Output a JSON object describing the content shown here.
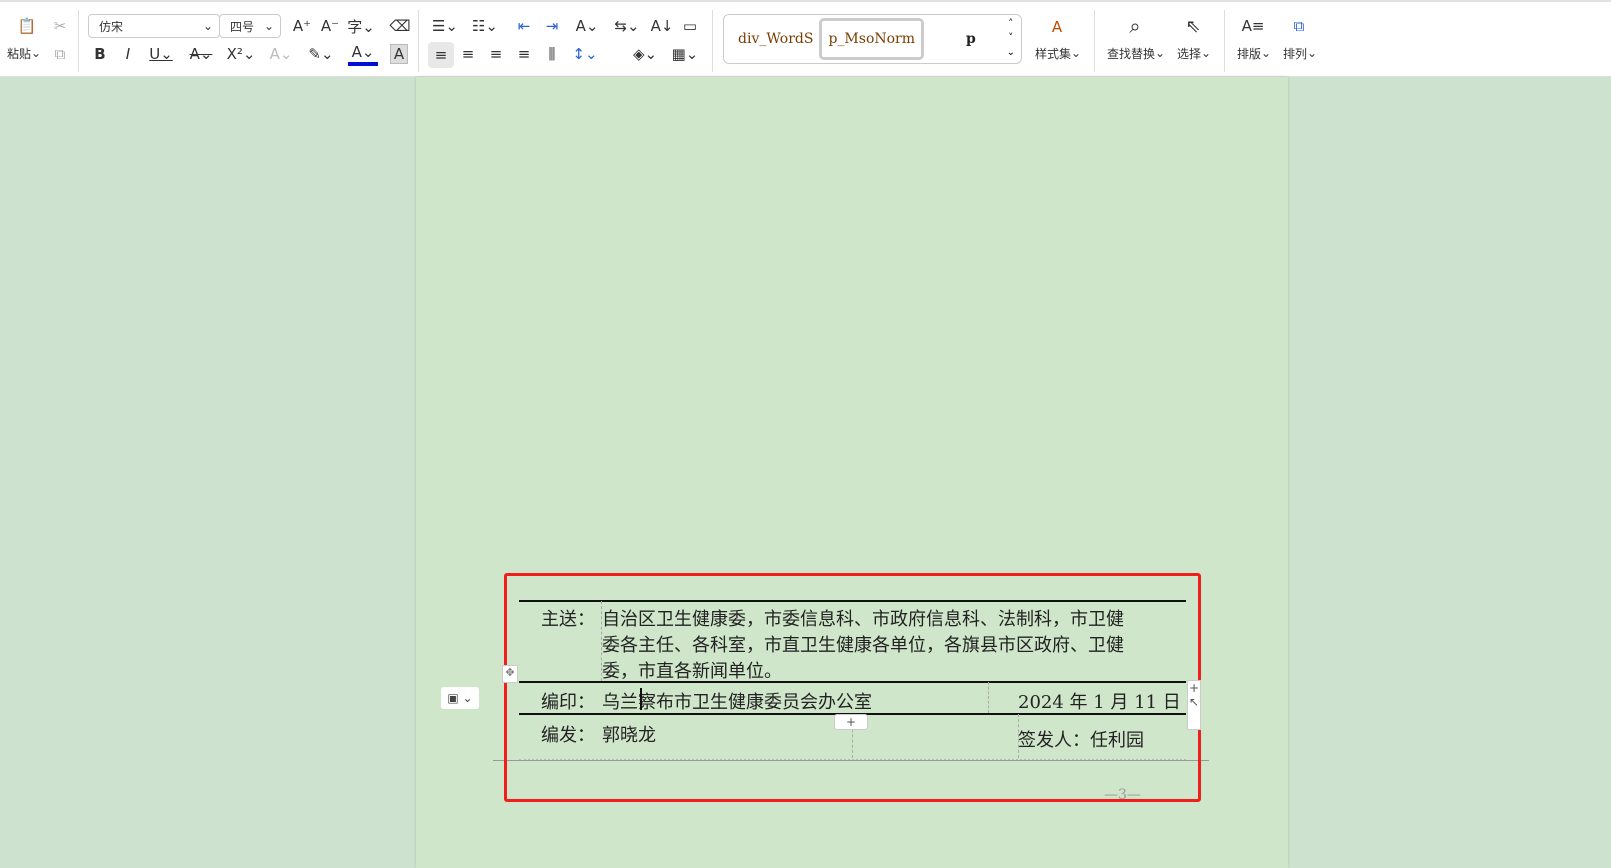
{
  "toolbar": {
    "paste": "粘贴",
    "font": "仿宋",
    "size": "四号",
    "styles": [
      "div_WordS",
      "p_MsoNorm",
      "p"
    ],
    "style_set": "样式集",
    "find_replace": "查找替换",
    "select": "选择",
    "layout": "排版",
    "arrange": "排列"
  },
  "document": {
    "rows": [
      {
        "label": "主送：",
        "lines": [
          "自治区卫生健康委，市委信息科、市政府信息科、法制科，市卫健",
          "委各主任、各科室，市直卫生健康各单位，各旗县市区政府、卫健",
          "委，市直各新闻单位。"
        ]
      },
      {
        "label": "编印：",
        "value": "乌兰察布市卫生健康委员会办公室",
        "date": "2024 年 1 月 11 日"
      },
      {
        "label": "编发：",
        "value": "郭晓龙",
        "signer": "签发人：任利园"
      }
    ],
    "page_number": "—3—"
  },
  "colors": {
    "highlight_box": "#f21d1d",
    "page_bg": "#cfe6ca"
  }
}
